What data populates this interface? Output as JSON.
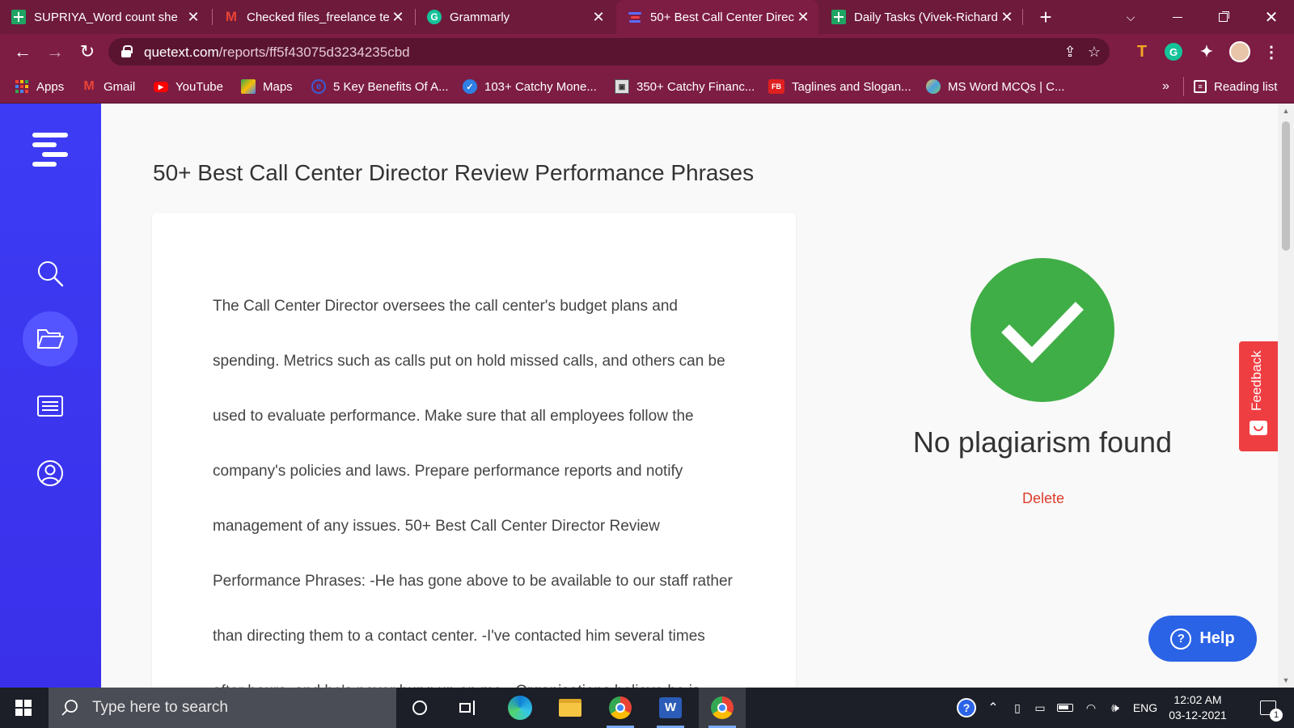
{
  "browser": {
    "tabs": [
      {
        "title": "SUPRIYA_Word count she",
        "favicon": "sheets-icon"
      },
      {
        "title": "Checked files_freelance te",
        "favicon": "gmail-icon"
      },
      {
        "title": "Grammarly",
        "favicon": "grammarly-icon"
      },
      {
        "title": "50+ Best Call Center Direc",
        "favicon": "quetext-icon",
        "active": true
      },
      {
        "title": "Daily Tasks (Vivek-Richard",
        "favicon": "sheets-icon"
      }
    ],
    "new_tab": "+",
    "url_host": "quetext.com",
    "url_path": "/reports/ff5f43075d3234235cbd",
    "bookmarks": [
      {
        "label": "Apps"
      },
      {
        "label": "Gmail"
      },
      {
        "label": "YouTube"
      },
      {
        "label": "Maps"
      },
      {
        "label": "5 Key Benefits Of A..."
      },
      {
        "label": "103+ Catchy Mone..."
      },
      {
        "label": "350+ Catchy Financ..."
      },
      {
        "label": "Taglines and Slogan...",
        "badge": "FB"
      },
      {
        "label": "MS Word MCQs | C..."
      }
    ],
    "overflow": "»",
    "reading_list": "Reading list",
    "ext_t": "T",
    "ext_g": "G"
  },
  "page": {
    "title": "50+ Best Call Center Director Review Performance Phrases",
    "body_text": "The Call Center Director oversees the call center's budget plans and spending. Metrics such as calls put on hold missed calls, and others can be used to evaluate performance. Make sure that all employees follow the company's policies and laws. Prepare performance reports and notify management of any issues. 50+ Best Call Center Director Review Performance Phrases: -He has gone above to be available to our staff rather than directing them to a contact center. -I've contacted him several times after hours, and he's never hung up on me. -Organisations believe he is",
    "result_title": "No plagiarism found",
    "delete_label": "Delete",
    "feedback_label": "Feedback",
    "help_label": "Help",
    "accent_color": "#3c3cf0",
    "success_color": "#3fae46"
  },
  "taskbar": {
    "search_placeholder": "Type here to search",
    "language": "ENG",
    "time": "12:02 AM",
    "date": "03-12-2021",
    "notification_count": "1"
  }
}
